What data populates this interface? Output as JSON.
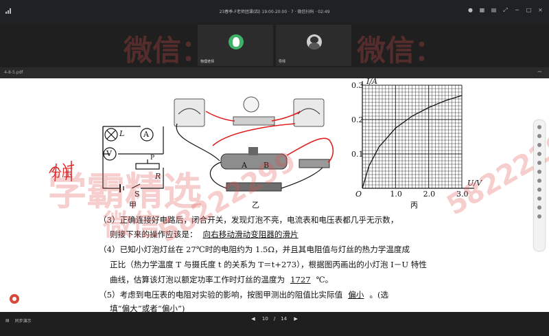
{
  "window": {
    "title": "23春季-F老师团课(四) 19:00-20:00 · 7 · 微信扫码 · 02:49"
  },
  "video_tiles": [
    {
      "name": "物理老师"
    },
    {
      "name": "导师"
    }
  ],
  "document": {
    "filename": "4-8-5.pdf"
  },
  "watermark": {
    "text_wechat": "微信：",
    "text_xuanxue": "学霸精选",
    "text_number": "58222299"
  },
  "handwriting": "分压",
  "figure": {
    "caption_jia": "甲",
    "caption_yi": "乙",
    "caption_bing": "丙",
    "circuit_labels": {
      "L": "L",
      "A": "A",
      "V": "V",
      "R": "R",
      "S": "S",
      "P": "P"
    },
    "yi_labels": {
      "A": "A",
      "B": "B"
    }
  },
  "chart_data": {
    "type": "line",
    "title": "",
    "xlabel": "U/V",
    "ylabel": "I/A",
    "xlim": [
      0,
      3.0
    ],
    "ylim": [
      0,
      0.3
    ],
    "x_ticks": [
      "1.0",
      "2.0",
      "3.0"
    ],
    "y_ticks": [
      "0.1",
      "0.2",
      "0.3"
    ],
    "origin_label": "O",
    "grid": true,
    "series": [
      {
        "x": [
          0,
          0.2,
          0.5,
          1.0,
          1.5,
          2.0,
          2.5,
          3.0
        ],
        "y": [
          0,
          0.065,
          0.12,
          0.175,
          0.21,
          0.235,
          0.255,
          0.27
        ]
      }
    ]
  },
  "questions": {
    "q3_line1": "（3）正确连接好电路后，闭合开关，发现灯泡不亮，电流表和电压表都几乎无示数，",
    "q3_line2": "则接下来的操作应该是：",
    "q3_answer": "向右移动滑动变阻器的滑片",
    "q4_line1": "（4）已知小灯泡灯丝在 27℃时的电阻约为 1.5Ω，并且其电阻值与灯丝的热力学温度成",
    "q4_line2": "正比（热力学温度 T 与摄氏度 t 的关系为 T＝t+273），根据图丙画出的小灯泡 I－U 特性",
    "q4_line3": "曲线，估算该灯泡以额定功率工作时灯丝的温度为",
    "q4_answer": "1727",
    "q4_unit": "℃。",
    "q5_line1": "（5）考虑到电压表的电阻对实验的影响，按图甲测出的阻值比实际值",
    "q5_answer": "偏小",
    "q5_after": "。(选",
    "q5_line2": "填“偏大”或者“偏小”)"
  },
  "bottom": {
    "left_label": "同步演示",
    "page_current": "10",
    "page_sep": "/",
    "page_total": "14"
  }
}
